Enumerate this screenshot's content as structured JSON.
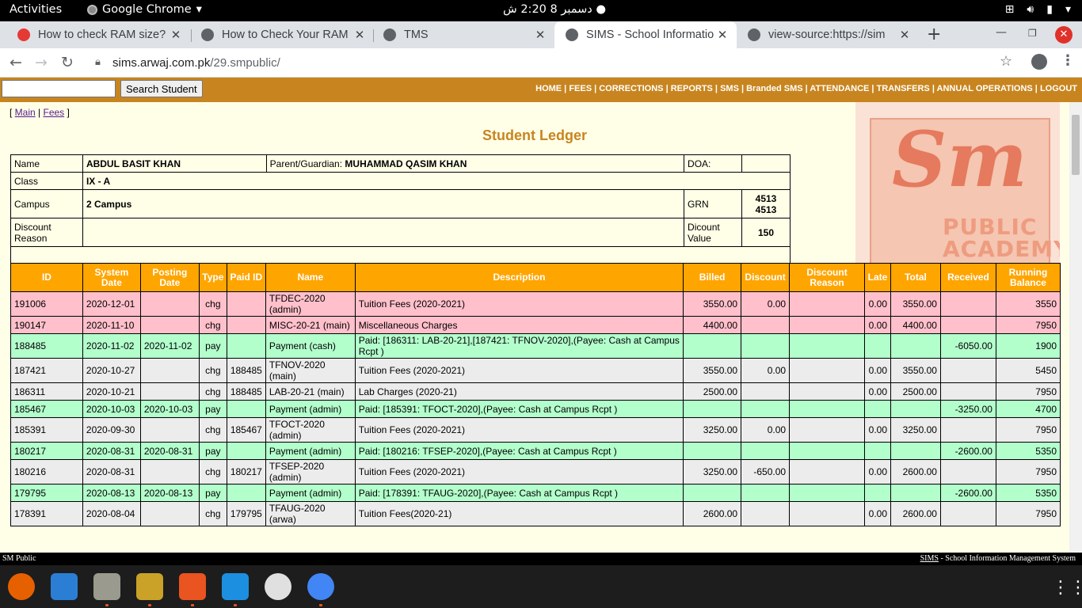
{
  "topbar": {
    "activities": "Activities",
    "app_name": "Google Chrome",
    "clock": "دسمبر 8  2:20 ش"
  },
  "tabs": [
    {
      "title": "How to check RAM size?",
      "favicon": "ask-icon",
      "color": "#e53935"
    },
    {
      "title": "How to Check Your RAM",
      "favicon": "globe-icon",
      "color": "#5f6368"
    },
    {
      "title": "TMS",
      "favicon": "globe-icon",
      "color": "#5f6368"
    },
    {
      "title": "SIMS - School Informatio",
      "favicon": "globe-icon",
      "color": "#5f6368",
      "active": true
    },
    {
      "title": "view-source:https://sim",
      "favicon": "globe-icon",
      "color": "#5f6368"
    }
  ],
  "address": {
    "host": "sims.arwaj.com.pk",
    "path": "/29.smpublic/"
  },
  "site": {
    "search_button": "Search Student",
    "search_value": "",
    "nav": "HOME | FEES | CORRECTIONS | REPORTS | SMS | Branded SMS | ATTENDANCE | TRANSFERS | ANNUAL OPERATIONS | LOGOUT",
    "crumb_main": "Main",
    "crumb_fees": "Fees",
    "title": "Student Ledger",
    "logo_text_1": "Sm",
    "logo_text_2": "PUBLIC",
    "logo_text_3": "ACADEMY"
  },
  "student": {
    "name_label": "Name",
    "name": "ABDUL BASIT KHAN",
    "parent_label": "Parent/Guardian:",
    "parent": "MUHAMMAD QASIM KHAN",
    "doa_label": "DOA:",
    "doa": "",
    "class_label": "Class",
    "class": "IX - A",
    "campus_label": "Campus",
    "campus": "2 Campus",
    "grn_label": "GRN",
    "grn_1": "4513",
    "grn_2": "4513",
    "discount_reason_label": "Discount Reason",
    "discount_reason": "",
    "discount_value_label": "Dicount Value",
    "discount_value": "150"
  },
  "ledger": {
    "headers": [
      "ID",
      "System Date",
      "Posting Date",
      "Type",
      "Paid ID",
      "Name",
      "Description",
      "Billed",
      "Discount",
      "Discount Reason",
      "Late",
      "Total",
      "Received",
      "Running Balance"
    ],
    "rows": [
      {
        "style": "pink",
        "cells": [
          "191006",
          "2020-12-01",
          "",
          "chg",
          "",
          "TFDEC-2020 (admin)",
          "Tuition Fees (2020-2021)",
          "3550.00",
          "0.00",
          "",
          "0.00",
          "3550.00",
          "",
          "3550"
        ]
      },
      {
        "style": "pink",
        "cells": [
          "190147",
          "2020-11-10",
          "",
          "chg",
          "",
          "MISC-20-21 (main)",
          "Miscellaneous Charges",
          "4400.00",
          "",
          "",
          "0.00",
          "4400.00",
          "",
          "7950"
        ]
      },
      {
        "style": "pay",
        "cells": [
          "188485",
          "2020-11-02",
          "2020-11-02",
          "pay",
          "",
          "Payment (cash)",
          "Paid: [186311: LAB-20-21],[187421: TFNOV-2020],(Payee: Cash at Campus Rcpt )",
          "",
          "",
          "",
          "",
          "",
          "-6050.00",
          "1900"
        ]
      },
      {
        "style": "chg",
        "cells": [
          "187421",
          "2020-10-27",
          "",
          "chg",
          "188485",
          "TFNOV-2020 (main)",
          "Tuition Fees (2020-2021)",
          "3550.00",
          "0.00",
          "",
          "0.00",
          "3550.00",
          "",
          "5450"
        ]
      },
      {
        "style": "chg",
        "cells": [
          "186311",
          "2020-10-21",
          "",
          "chg",
          "188485",
          "LAB-20-21 (main)",
          "Lab Charges (2020-21)",
          "2500.00",
          "",
          "",
          "0.00",
          "2500.00",
          "",
          "7950"
        ]
      },
      {
        "style": "pay",
        "cells": [
          "185467",
          "2020-10-03",
          "2020-10-03",
          "pay",
          "",
          "Payment (admin)",
          "Paid: [185391: TFOCT-2020],(Payee: Cash at Campus Rcpt )",
          "",
          "",
          "",
          "",
          "",
          "-3250.00",
          "4700"
        ]
      },
      {
        "style": "chg",
        "cells": [
          "185391",
          "2020-09-30",
          "",
          "chg",
          "185467",
          "TFOCT-2020 (admin)",
          "Tuition Fees (2020-2021)",
          "3250.00",
          "0.00",
          "",
          "0.00",
          "3250.00",
          "",
          "7950"
        ]
      },
      {
        "style": "pay",
        "cells": [
          "180217",
          "2020-08-31",
          "2020-08-31",
          "pay",
          "",
          "Payment (admin)",
          "Paid: [180216: TFSEP-2020],(Payee: Cash at Campus Rcpt )",
          "",
          "",
          "",
          "",
          "",
          "-2600.00",
          "5350"
        ]
      },
      {
        "style": "chg",
        "cells": [
          "180216",
          "2020-08-31",
          "",
          "chg",
          "180217",
          "TFSEP-2020 (admin)",
          "Tuition Fees (2020-2021)",
          "3250.00",
          "-650.00",
          "",
          "0.00",
          "2600.00",
          "",
          "7950"
        ]
      },
      {
        "style": "pay",
        "cells": [
          "179795",
          "2020-08-13",
          "2020-08-13",
          "pay",
          "",
          "Payment (admin)",
          "Paid: [178391: TFAUG-2020],(Payee: Cash at Campus Rcpt )",
          "",
          "",
          "",
          "",
          "",
          "-2600.00",
          "5350"
        ]
      },
      {
        "style": "chg",
        "cells": [
          "178391",
          "2020-08-04",
          "",
          "chg",
          "179795",
          "TFAUG-2020 (arwa)",
          "Tuition Fees(2020-21)",
          "2600.00",
          "",
          "",
          "0.00",
          "2600.00",
          "",
          "7950"
        ]
      }
    ]
  },
  "statusbar": {
    "left": "SM Public",
    "right_link": "SIMS",
    "right_text": " - School Information Management System"
  },
  "dock": [
    {
      "name": "firefox-icon",
      "color": "#e66000"
    },
    {
      "name": "writer-icon",
      "color": "#2a7fd4"
    },
    {
      "name": "files-icon",
      "color": "#9a9a8e"
    },
    {
      "name": "app-icon",
      "color": "#c9a227"
    },
    {
      "name": "screenshot-icon",
      "color": "#e95420"
    },
    {
      "name": "shark-icon",
      "color": "#1d8fe0"
    },
    {
      "name": "software-icon",
      "color": "#e0e0e0"
    },
    {
      "name": "chrome-icon",
      "color": "#4285f4"
    }
  ]
}
